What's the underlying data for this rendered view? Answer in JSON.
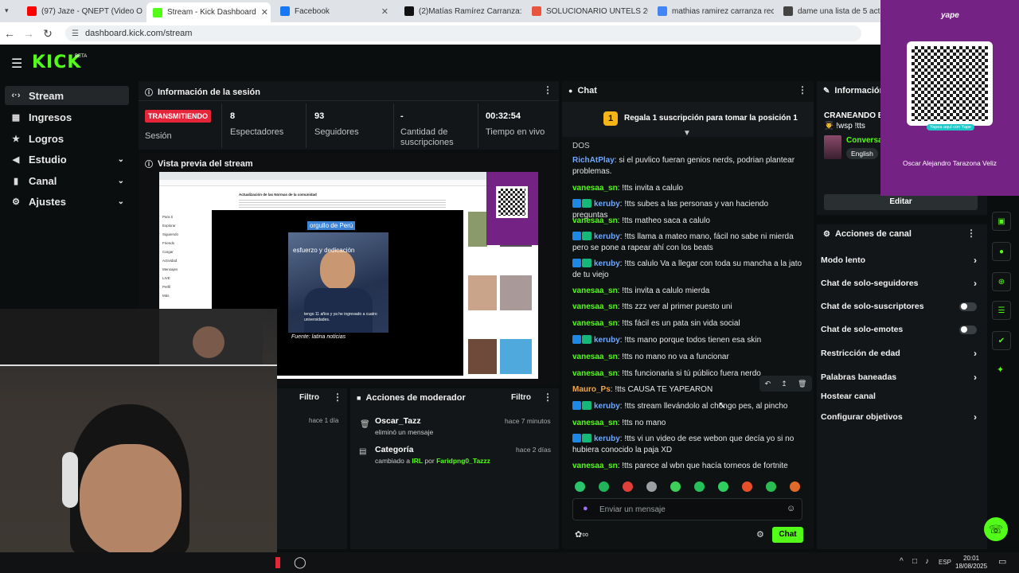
{
  "browser": {
    "tabs": [
      {
        "title": "(97) Jaze - QNEPT (Video O",
        "color": "#ff0000"
      },
      {
        "title": "Stream - Kick Dashboard",
        "color": "#53fc18",
        "active": true
      },
      {
        "title": "Facebook",
        "color": "#1877f2"
      },
      {
        "title": "(2)Matías Ramírez Carranza: Ing",
        "color": "#111111"
      },
      {
        "title": "SOLUCIONARIO UNTELS 2026",
        "color": "#e8543e"
      },
      {
        "title": "mathias ramirez carranza recor",
        "color": "#4285f4"
      },
      {
        "title": "dame una lista de 5 actividad",
        "color": "#444444"
      }
    ],
    "url": "dashboard.kick.com/stream"
  },
  "header": {
    "logo": "KICK",
    "beta": "BETA"
  },
  "sidebar": {
    "items": [
      {
        "label": "Stream",
        "icon": "signal-icon"
      },
      {
        "label": "Ingresos",
        "icon": "money-icon"
      },
      {
        "label": "Logros",
        "icon": "trophy-icon"
      },
      {
        "label": "Estudio",
        "icon": "studio-icon",
        "chevron": true
      },
      {
        "label": "Canal",
        "icon": "channel-icon",
        "chevron": true
      },
      {
        "label": "Ajustes",
        "icon": "gear-icon",
        "chevron": true
      }
    ]
  },
  "session": {
    "title": "Información de la sesión",
    "status": "TRANSMITIENDO",
    "status_label": "Sesión",
    "stats": [
      {
        "value": "8",
        "label": "Espectadores"
      },
      {
        "value": "93",
        "label": "Seguidores"
      },
      {
        "value": "-",
        "label": "Cantidad de suscripciones"
      },
      {
        "value": "00:32:54",
        "label": "Tiempo en vivo"
      }
    ]
  },
  "preview": {
    "title": "Vista previa del stream",
    "overlay_tag": "orgullo de Perú",
    "overlay_caption": "esfuerzo y dedicación",
    "overlay_sub": "tengo 11 años y ya he ingresado a cuatro universidades.",
    "overlay_source": "Fuente: latina noticias",
    "inner_heading": "Actualización de las Normas de la comunidad",
    "inner_menu": [
      "Para ti",
      "Explorar",
      "Siguiendo",
      "Friends",
      "Cargar",
      "Actividad",
      "Mensajes",
      "LIVE",
      "Perfil",
      "Más"
    ]
  },
  "filters": {
    "left_filter": "Filtro",
    "left_time": "hace 1 día"
  },
  "mod_actions": {
    "title": "Acciones de moderador",
    "filter": "Filtro",
    "entries": [
      {
        "user": "Oscar_Tazz",
        "action": "eliminó un mensaje",
        "time": "hace 7 minutos"
      },
      {
        "user": "Categoría",
        "action_prefix": "cambiado a",
        "target": "IRL",
        "by": "por",
        "actor": "Faridpng0_Tazzz",
        "time": "hace 2 días"
      }
    ]
  },
  "chat": {
    "title": "Chat",
    "pinned_rank": "1",
    "pinned_text": "Regala 1 suscripción para tomar la posición 1",
    "top_cut": "DOS",
    "messages": [
      {
        "user": "RichAtPlay",
        "color": "b",
        "text": "si el puvlico fueran genios nerds, podrian plantear problemas.",
        "badges": false
      },
      {
        "user": "vanesaa_sn",
        "color": "g",
        "text": "!tts invita a calulo",
        "badges": false
      },
      {
        "user": "keruby",
        "color": "b",
        "text": "!tts subes a las personas y van haciendo preguntas",
        "badges": true
      },
      {
        "user": "vanesaa_sn",
        "color": "g",
        "text": "!tts matheo saca a calulo",
        "badges": false
      },
      {
        "user": "keruby",
        "color": "b",
        "text": "!tts llama a mateo mano, fácil no sabe ni mierda pero se pone a rapear ahí con los beats",
        "badges": true
      },
      {
        "user": "keruby",
        "color": "b",
        "text": "!tts calulo Va a llegar con toda su mancha a la jato de tu viejo",
        "badges": true
      },
      {
        "user": "vanesaa_sn",
        "color": "g",
        "text": "!tts invita a calulo mierda",
        "badges": false
      },
      {
        "user": "vanesaa_sn",
        "color": "g",
        "text": "!tts zzz ver al primer puesto uni",
        "badges": false
      },
      {
        "user": "vanesaa_sn",
        "color": "g",
        "text": "!tts fácil es un pata sin vida social",
        "badges": false
      },
      {
        "user": "keruby",
        "color": "b",
        "text": "!tts mano porque todos tienen esa skin",
        "badges": true
      },
      {
        "user": "vanesaa_sn",
        "color": "g",
        "text": "!tts no mano no va a funcionar",
        "badges": false
      },
      {
        "user": "vanesaa_sn",
        "color": "g",
        "text": "!tts funcionaria si tú público fuera nerdo",
        "badges": false
      },
      {
        "user": "Mauro_Ps",
        "color": "o",
        "text": "!tts CAUSA TE YAPEARON",
        "badges": false
      },
      {
        "user": "keruby",
        "color": "b",
        "text": "!tts stream llevándolo al chongo pes, al pincho",
        "badges": true
      },
      {
        "user": "vanesaa_sn",
        "color": "g",
        "text": "!tts no mano",
        "badges": false
      },
      {
        "user": "keruby",
        "color": "b",
        "text": "!tts vi un video de ese webon que decía yo si no hubiera conocido la paja XD",
        "badges": true
      },
      {
        "user": "vanesaa_sn",
        "color": "g",
        "text": "!tts parece al wbn que hacía torneos de fortnite",
        "badges": false
      }
    ],
    "input_placeholder": "Enviar un mensaje",
    "send_label": "Chat"
  },
  "channel_info": {
    "title": "Información d",
    "stream_title": "CRANEANDO EV",
    "stream_sub": "👨‍🎓 !wsp !tts",
    "category": "Conversa",
    "language": "English",
    "edit_label": "Editar"
  },
  "yape": {
    "brand": "yape",
    "caption": "Yapea aquí con Yape",
    "owner": "Oscar Alejandro Tarazona Veliz"
  },
  "channel_actions": {
    "title": "Acciones de canal",
    "items": [
      {
        "label": "Modo lento",
        "kind": "chevron"
      },
      {
        "label": "Chat de solo-seguidores",
        "kind": "chevron"
      },
      {
        "label": "Chat de solo-suscriptores",
        "kind": "toggle"
      },
      {
        "label": "Chat de solo-emotes",
        "kind": "toggle"
      },
      {
        "label": "Restricción de edad",
        "kind": "chevron"
      },
      {
        "label": "Palabras baneadas",
        "kind": "chevron"
      },
      {
        "label": "Hostear canal",
        "kind": "none"
      },
      {
        "label": "Configurar objetivos",
        "kind": "chevron"
      }
    ]
  },
  "taskbar": {
    "lang": "ESP",
    "time": "20:01",
    "date": "18/08/2025"
  },
  "colors": {
    "accent": "#53fc18",
    "live": "#e5263a",
    "yape": "#742284"
  }
}
